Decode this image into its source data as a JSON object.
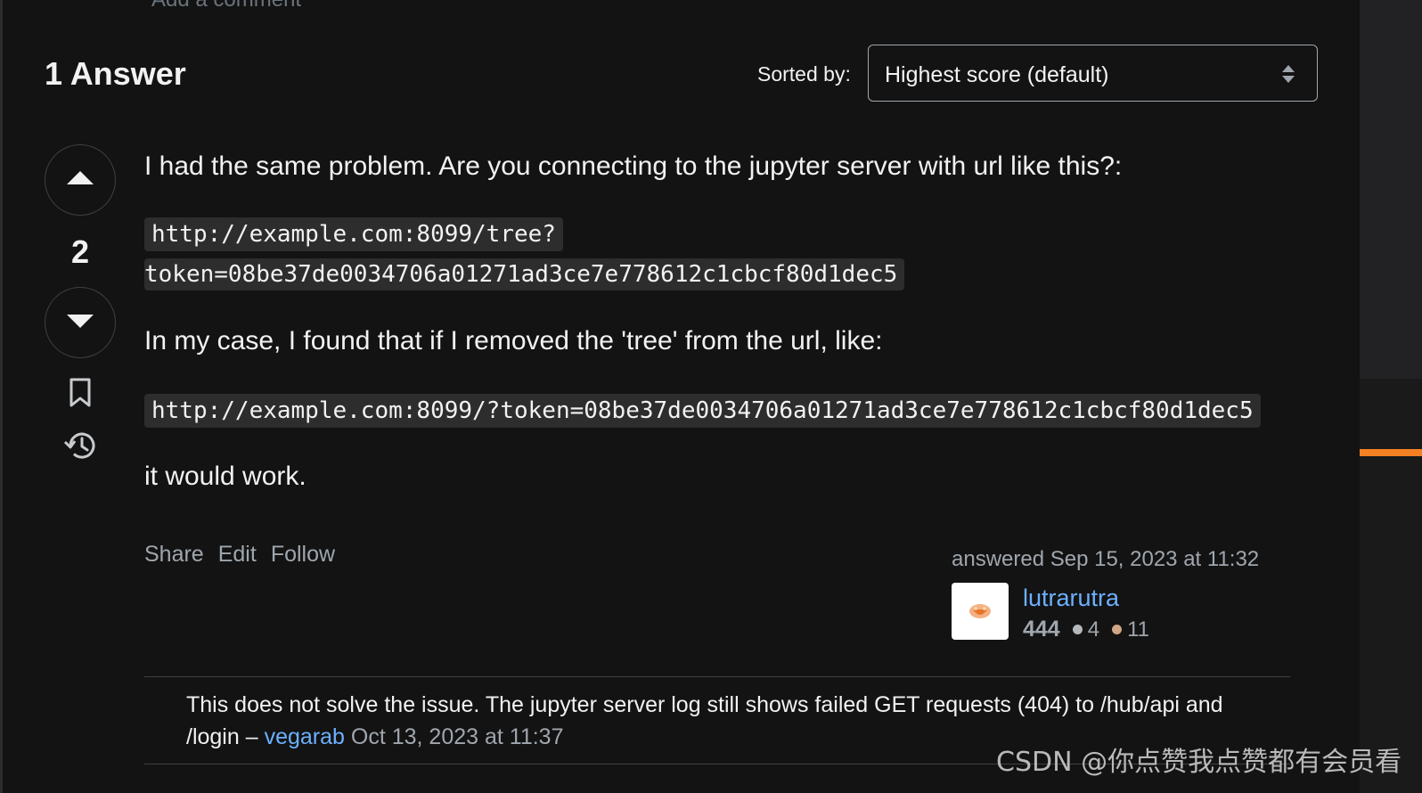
{
  "header": {
    "cut_text": "Add a comment",
    "answers_title": "1 Answer",
    "sort_label": "Sorted by:",
    "sort_value": "Highest score (default)"
  },
  "vote": {
    "count": "2"
  },
  "answer": {
    "paragraph1": "I had the same problem. Are you connecting to the jupyter server with url like this?:",
    "code1_line1": "http://example.com:8099/tree?",
    "code1_line2": "token=08be37de0034706a01271ad3ce7e778612c1cbcf80d1dec5",
    "paragraph2": "In my case, I found that if I removed the 'tree' from the url, like:",
    "code2": "http://example.com:8099/?token=08be37de0034706a01271ad3ce7e778612c1cbcf80d1dec5",
    "paragraph3": "it would work."
  },
  "post_menu": {
    "share": "Share",
    "edit": "Edit",
    "follow": "Follow"
  },
  "user_card": {
    "answered_time": "answered Sep 15, 2023 at 11:32",
    "user_name": "lutrarutra",
    "reputation": "444",
    "silver_badges": "4",
    "bronze_badges": "11"
  },
  "comment": {
    "text": "This does not solve the issue. The jupyter server log still shows failed GET requests (404) to /hub/api and /login – ",
    "user": "vegarab",
    "date": "Oct 13, 2023 at 11:37"
  },
  "watermark": "CSDN @你点赞我点赞都有会员看",
  "colors": {
    "background": "#131313",
    "link": "#6cb0ff",
    "muted": "#9fa6ad",
    "code_bg": "#2d2d2d",
    "accent": "#f48024",
    "silver_badge": "#b4b8bc",
    "bronze_badge": "#d1a684"
  },
  "icons": [
    "chevron-up-icon",
    "chevron-down-icon",
    "bookmark-icon",
    "history-icon",
    "sort-arrows-icon"
  ]
}
